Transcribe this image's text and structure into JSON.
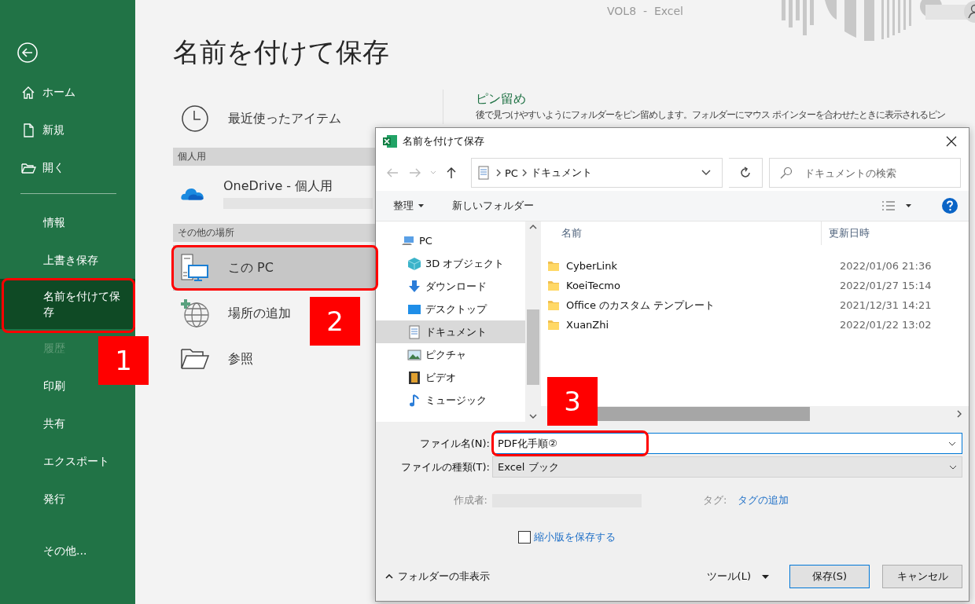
{
  "window_title": "VOL8  -  Excel",
  "sidebar": {
    "nav": [
      {
        "label": "ホーム"
      },
      {
        "label": "新規"
      },
      {
        "label": "開く"
      }
    ],
    "items": [
      {
        "label": "情報",
        "selected": false,
        "disabled": false
      },
      {
        "label": "上書き保存",
        "selected": false,
        "disabled": false
      },
      {
        "label": "名前を付けて保存",
        "selected": true,
        "disabled": false
      },
      {
        "label": "履歴",
        "selected": false,
        "disabled": true
      },
      {
        "label": "印刷",
        "selected": false,
        "disabled": false
      },
      {
        "label": "共有",
        "selected": false,
        "disabled": false
      },
      {
        "label": "エクスポート",
        "selected": false,
        "disabled": false
      },
      {
        "label": "発行",
        "selected": false,
        "disabled": false
      }
    ],
    "more": "その他..."
  },
  "page_title": "名前を付けて保存",
  "places": [
    {
      "kind": "item",
      "label": "最近使ったアイテム",
      "selected": false
    },
    {
      "kind": "header",
      "label": "個人用"
    },
    {
      "kind": "account",
      "label": "OneDrive - 個人用",
      "selected": false
    },
    {
      "kind": "header",
      "label": "その他の場所"
    },
    {
      "kind": "item",
      "label": "この PC",
      "selected": true
    },
    {
      "kind": "item",
      "label": "場所の追加",
      "selected": false
    },
    {
      "kind": "item",
      "label": "参照",
      "selected": false
    }
  ],
  "pin": {
    "title": "ピン留め",
    "description": "後で見つけやすいようにフォルダーをピン留めします。フォルダーにマウス ポインターを合わせたときに表示されるピン"
  },
  "dialog": {
    "title": "名前を付けて保存",
    "path": [
      "PC",
      "ドキュメント"
    ],
    "search_placeholder": "ドキュメントの検索",
    "organize": "整理",
    "new_folder": "新しいフォルダー",
    "tree": [
      {
        "label": "PC",
        "selected": false
      },
      {
        "label": "3D オブジェクト",
        "selected": false
      },
      {
        "label": "ダウンロード",
        "selected": false
      },
      {
        "label": "デスクトップ",
        "selected": false
      },
      {
        "label": "ドキュメント",
        "selected": true
      },
      {
        "label": "ピクチャ",
        "selected": false
      },
      {
        "label": "ビデオ",
        "selected": false
      },
      {
        "label": "ミュージック",
        "selected": false
      }
    ],
    "columns": [
      "名前",
      "更新日時"
    ],
    "files": [
      {
        "name": "CyberLink",
        "modified": "2022/01/06 21:36"
      },
      {
        "name": "KoeiTecmo",
        "modified": "2022/01/27 15:14"
      },
      {
        "name": "Office のカスタム テンプレート",
        "modified": "2021/12/31 14:21"
      },
      {
        "name": "XuanZhi",
        "modified": "2022/01/22 13:02"
      }
    ],
    "filename_label": "ファイル名(N):",
    "filename": "PDF化手順②",
    "filetype_label": "ファイルの種類(T):",
    "filetype": "Excel ブック",
    "author_label": "作成者:",
    "tags_label": "タグ:",
    "tags_link": "タグの追加",
    "thumbnail": {
      "label": "縮小版を保存する",
      "checked": false
    },
    "hide_folders": "フォルダーの非表示",
    "tools": "ツール(L)",
    "save": "保存(S)",
    "cancel": "キャンセル"
  },
  "annotations": [
    {
      "number": "1"
    },
    {
      "number": "2"
    },
    {
      "number": "3"
    }
  ]
}
